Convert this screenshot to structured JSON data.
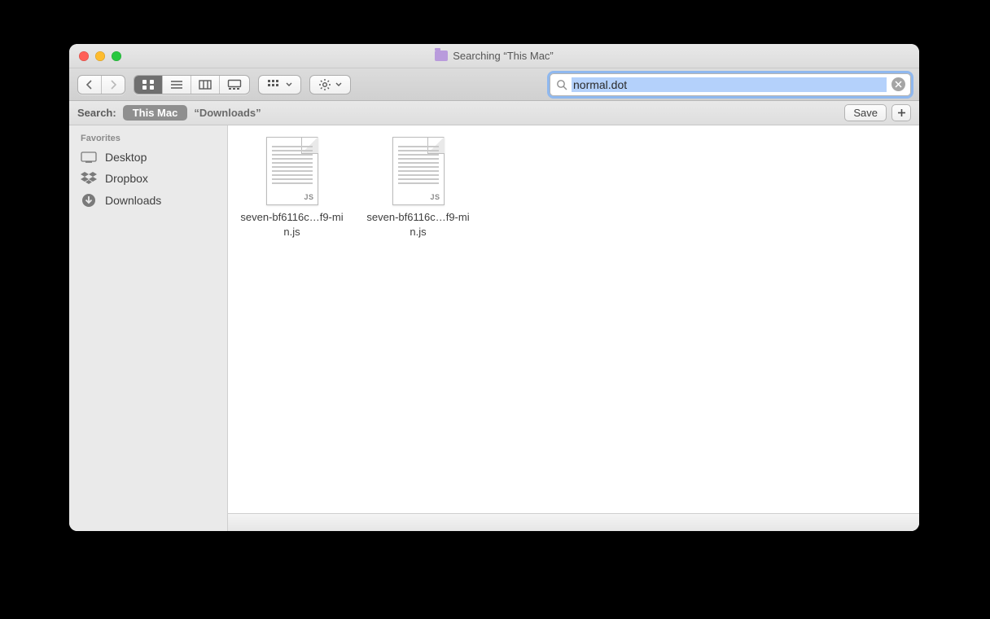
{
  "window": {
    "title": "Searching “This Mac”"
  },
  "toolbar": {
    "search_value": "normal.dot"
  },
  "scope": {
    "label": "Search:",
    "selected": "This Mac",
    "other": "“Downloads”",
    "save_label": "Save"
  },
  "sidebar": {
    "header": "Favorites",
    "items": [
      {
        "label": "Desktop",
        "icon": "desktop"
      },
      {
        "label": "Dropbox",
        "icon": "dropbox"
      },
      {
        "label": "Downloads",
        "icon": "downloads"
      }
    ]
  },
  "results": [
    {
      "filename": "seven-bf6116c…f9-min.js",
      "badge": "JS"
    },
    {
      "filename": "seven-bf6116c…f9-min.js",
      "badge": "JS"
    }
  ]
}
